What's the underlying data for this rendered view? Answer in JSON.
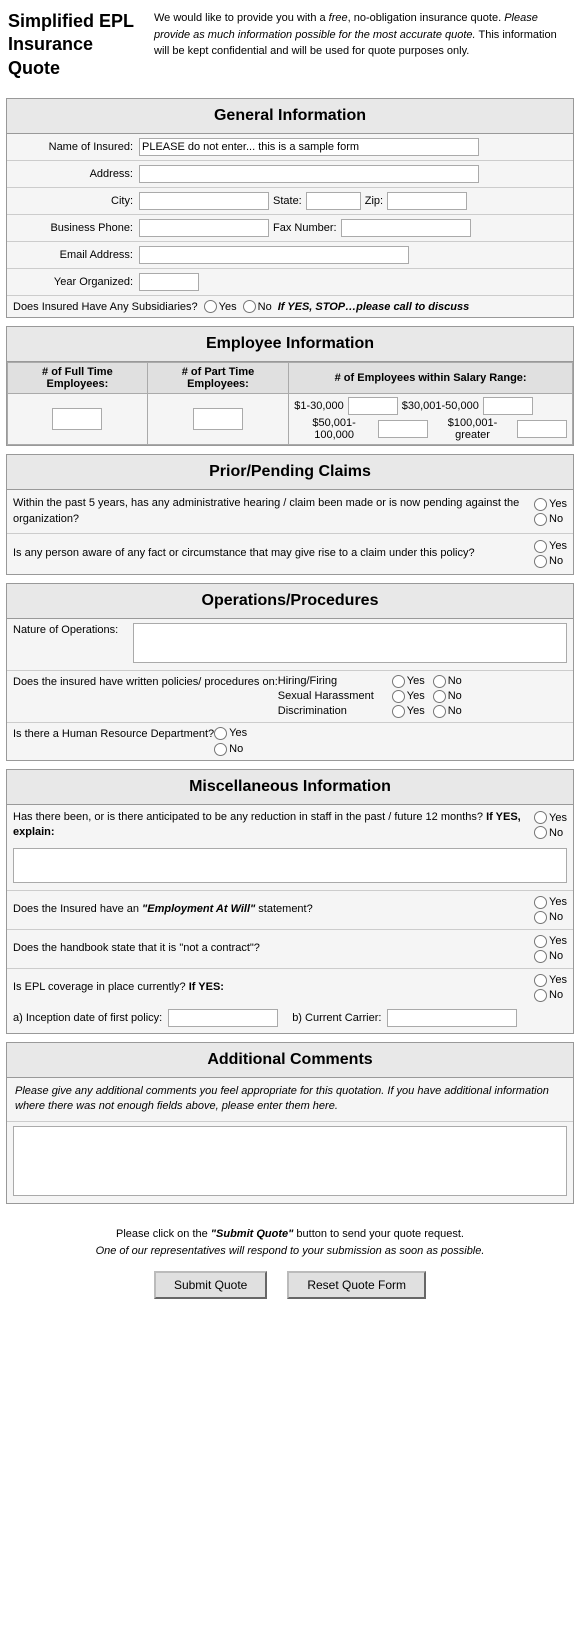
{
  "header": {
    "title": "Simplified EPL Insurance Quote",
    "description_parts": [
      "We would like to provide you with a ",
      "free",
      ", no-obligation insurance quote. ",
      "Please provide as much information possible for the most accurate quote.",
      " This information will be kept confidential and will be used for quote purposes only."
    ]
  },
  "general": {
    "title": "General Information",
    "name_label": "Name of Insured:",
    "name_placeholder": "PLEASE do not enter... this is a sample form",
    "address_label": "Address:",
    "city_label": "City:",
    "state_label": "State:",
    "zip_label": "Zip:",
    "phone_label": "Business Phone:",
    "fax_label": "Fax Number:",
    "email_label": "Email Address:",
    "year_label": "Year Organized:",
    "subsidiaries_label": "Does Insured Have Any Subsidiaries?",
    "subsidiaries_yes": "Yes",
    "subsidiaries_no": "No",
    "subsidiaries_stop": "If YES, STOP…please call to discuss"
  },
  "employee": {
    "title": "Employee Information",
    "col1": "# of Full Time Employees:",
    "col2": "# of Part Time Employees:",
    "col3": "# of Employees within Salary Range:",
    "salary_ranges": [
      {
        "label": "$1-30,000",
        "label2": "$30,001-50,000"
      },
      {
        "label": "$50,001-100,000",
        "label2": "$100,001-greater"
      }
    ]
  },
  "claims": {
    "title": "Prior/Pending Claims",
    "q1": "Within the past 5 years, has any administrative hearing / claim been made or is now pending against the organization?",
    "q2": "Is any person aware of any fact or circumstance that may give rise to a claim under this policy?",
    "yes": "Yes",
    "no": "No"
  },
  "operations": {
    "title": "Operations/Procedures",
    "nature_label": "Nature of Operations:",
    "policies_label": "Does the insured have written policies/ procedures on:",
    "hr_label": "Is there a Human Resource Department?",
    "hiring": "Hiring/Firing",
    "sexual": "Sexual Harassment",
    "discrimination": "Discrimination",
    "yes": "Yes",
    "no": "No"
  },
  "misc": {
    "title": "Miscellaneous Information",
    "q1_part1": "Has there been, or is there anticipated to be any reduction in staff in the past / future 12 months?",
    "q1_bold": "If YES, explain:",
    "q2_part1": "Does the Insured have an ",
    "q2_italic": "“Employment At Will”",
    "q2_part2": " statement?",
    "q3": "Does the handbook state that it is \"not a contract\"?",
    "q4_part1": "Is EPL coverage in place currently?",
    "q4_bold": "If YES:",
    "inception_label": "a) Inception date of first policy:",
    "carrier_label": "b) Current Carrier:",
    "yes": "Yes",
    "no": "No"
  },
  "comments": {
    "title": "Additional Comments",
    "description": "Please give any additional comments you feel appropriate for this quotation. If you have additional information where there was not enough fields above, please enter them here."
  },
  "footer": {
    "line1_pre": "Please click on the ",
    "line1_bold": "\"Submit Quote\"",
    "line1_post": " button to send your quote request.",
    "line2": "One of our representatives will respond to your submission as soon as possible.",
    "submit_btn": "Submit Quote",
    "reset_btn": "Reset Quote Form"
  }
}
